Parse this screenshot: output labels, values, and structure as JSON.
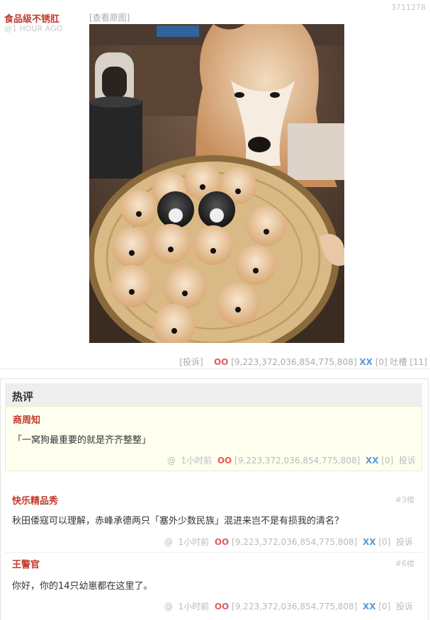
{
  "post": {
    "id": "3711278",
    "author": "食品级不锈肛",
    "time": "@1 HOUR AGO",
    "view_original": "[查看原图]",
    "report": "[投诉]",
    "oo_label": "OO",
    "oo_count": "[9,223,372,036,854,775,808]",
    "xx_label": "XX",
    "xx_count": "[0]",
    "tucao_label": "吐槽",
    "tucao_count": "[11]"
  },
  "hot": {
    "title": "热评",
    "comment": {
      "author": "商周知",
      "text": "「一窝狗最重要的就是齐齐整整」",
      "at": "@",
      "time": "1小时前",
      "oo_label": "OO",
      "oo_count": "[9,223,372,036,854,775,808]",
      "xx_label": "XX",
      "xx_count": "[0]",
      "report": "投诉"
    }
  },
  "comments": [
    {
      "author": "快乐精品秀",
      "floor": "#3楼",
      "text": "秋田倭寇可以理解，赤峰承德两只「塞外少数民族」混进来岂不是有损我的清名？",
      "at": "@",
      "time": "1小时前",
      "oo_label": "OO",
      "oo_count": "[9,223,372,036,854,775,808]",
      "xx_label": "XX",
      "xx_count": "[0]",
      "report": "投诉"
    },
    {
      "author": "王警官",
      "floor": "#6楼",
      "text": "你好，你的14只幼崽都在这里了。",
      "at": "@",
      "time": "1小时前",
      "oo_label": "OO",
      "oo_count": "[9,223,372,036,854,775,808]",
      "xx_label": "XX",
      "xx_count": "[0]",
      "report": "投诉"
    }
  ]
}
